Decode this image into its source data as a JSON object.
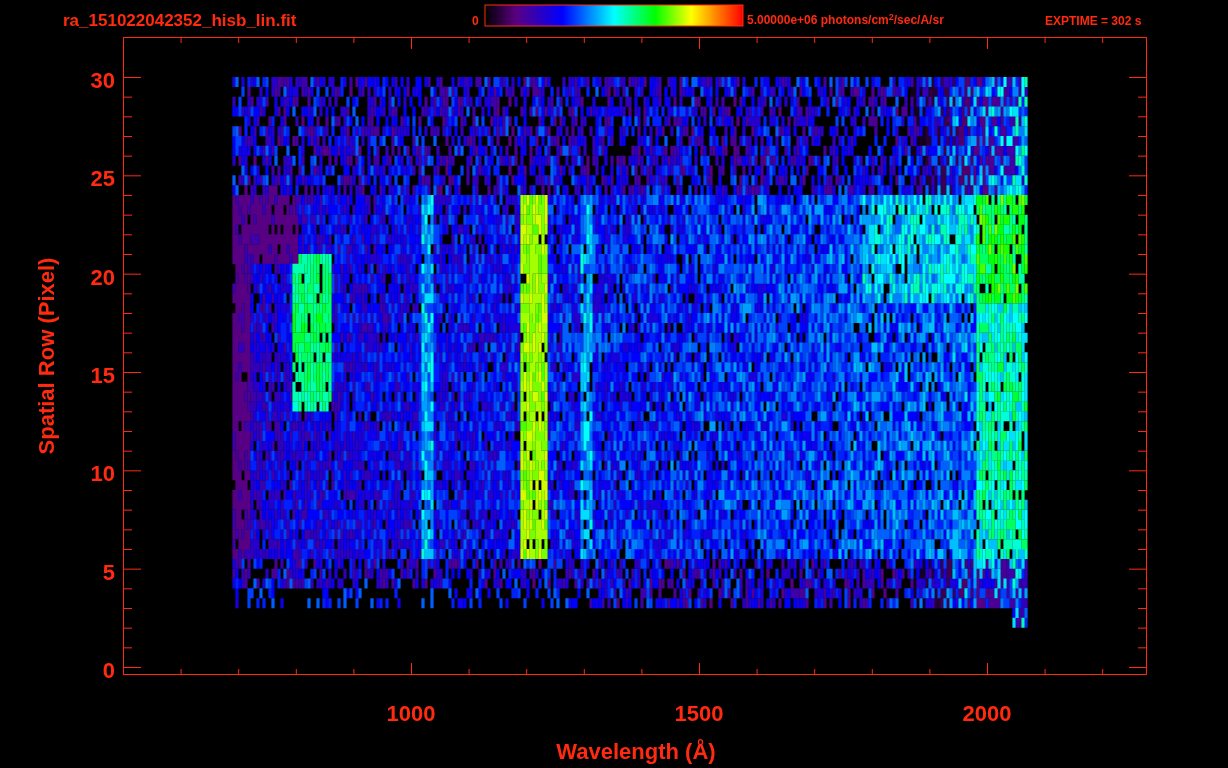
{
  "title": "ra_151022042352_hisb_lin.fit",
  "colorbar": {
    "min_label": "0",
    "max_label": "5.00000e+06 photons/cm$^{2}$/sec/A/sr"
  },
  "exposure": "EXPTIME = 302 s",
  "plot": {
    "xlabel": "Wavelength (Å)",
    "ylabel": "Spatial Row (Pixel)",
    "xticks": [
      "1000",
      "1500",
      "2000"
    ],
    "yticks": [
      "30",
      "25",
      "20",
      "15",
      "10",
      "5",
      "0"
    ]
  }
}
